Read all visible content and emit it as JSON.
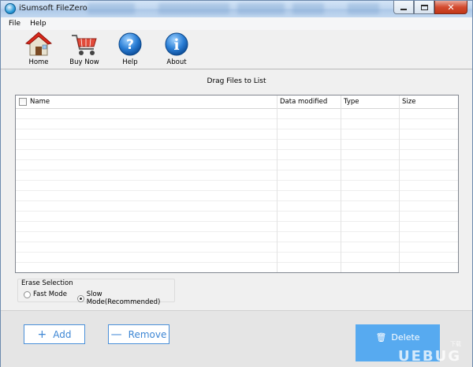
{
  "window": {
    "title": "iSumsoft FileZero"
  },
  "menu": {
    "items": [
      "File",
      "Help"
    ]
  },
  "toolbar": {
    "buttons": [
      {
        "label": "Home",
        "icon": "home-icon"
      },
      {
        "label": "Buy Now",
        "icon": "shopping-cart-icon"
      },
      {
        "label": "Help",
        "icon": "help-icon"
      },
      {
        "label": "About",
        "icon": "info-icon"
      }
    ]
  },
  "main": {
    "drag_label": "Drag Files to List",
    "columns": [
      "Name",
      "Data modified",
      "Type",
      "Size"
    ],
    "rows": []
  },
  "erase_selection": {
    "title": "Erase Selection",
    "options": [
      "Fast Mode",
      "Slow Mode(Recommended)"
    ],
    "selected": "Slow Mode(Recommended)"
  },
  "actions": {
    "add_label": "Add",
    "remove_label": "Remove",
    "delete_label": "Delete"
  },
  "watermark": {
    "text": "UEBUG",
    "sub": "下载"
  },
  "colors": {
    "accent": "#3d86d4",
    "delete_bg": "#57aaf0",
    "close_btn": "#c13718"
  }
}
